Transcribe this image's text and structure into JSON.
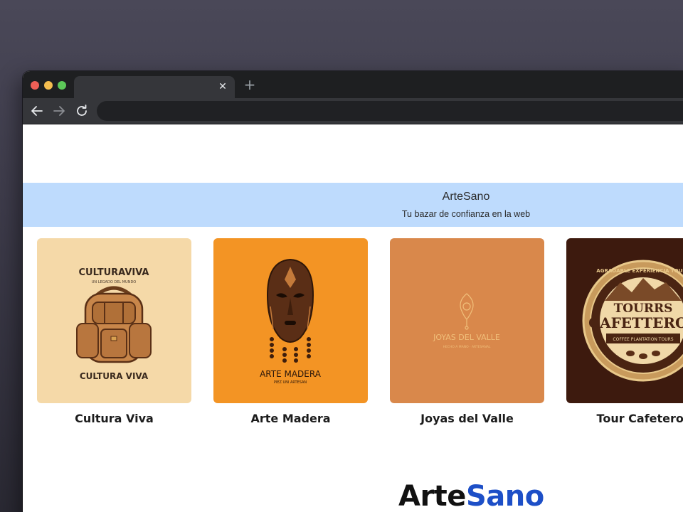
{
  "browser": {
    "tab_title": "",
    "tab_close_icon": "close-icon",
    "new_tab_icon": "plus-icon",
    "url": "",
    "nav_icons": [
      "back-arrow-icon",
      "forward-arrow-icon",
      "reload-icon"
    ]
  },
  "site": {
    "title": "ArteSano",
    "subtitle": "Tu bazar de confianza en la web",
    "band_color": "#bedbfd"
  },
  "cards": [
    {
      "label": "Cultura Viva",
      "image_text_top": "CULTURAVIVA",
      "image_text_arc": "UN LEGADO DEL MUNDO",
      "image_text_bottom": "CULTURA VIVA",
      "bg": "#f5d9a8"
    },
    {
      "label": "Arte Madera",
      "image_text_bottom": "ARTE MADERA",
      "image_text_small": "PIEZ UNI ARTESAN",
      "bg": "#f39424"
    },
    {
      "label": "Joyas del Valle",
      "image_text": "JOYAS DEL VALLE",
      "image_text_small": "HECHO A MANO · ARTESANAL",
      "bg": "#d9884b"
    },
    {
      "label": "Tour Cafeteros",
      "image_text_main1": "TOURRS",
      "image_text_main2": "CAFETTEROS",
      "image_text_ring": "AGRADABLE EXPERIENCIA TOURS",
      "image_text_band": "COFFEE PLANTATION TOURS",
      "bg": "#3d1a0e"
    }
  ],
  "footer": {
    "logo_part1": "Arte",
    "logo_part2": "Sano"
  }
}
